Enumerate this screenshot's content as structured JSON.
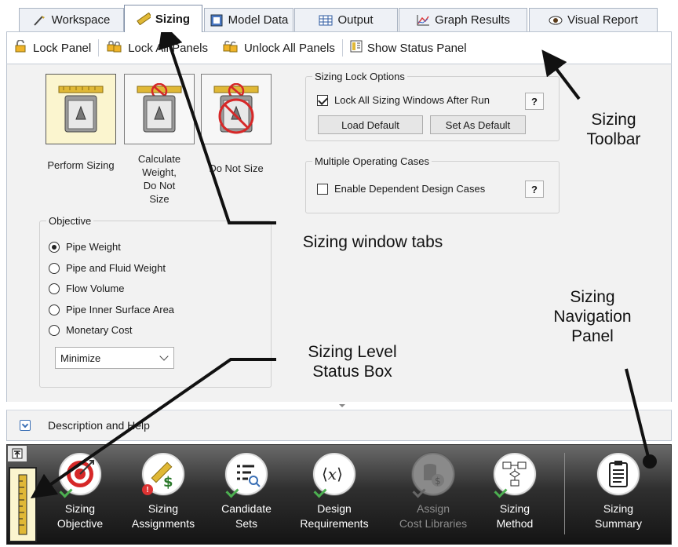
{
  "tabs": [
    {
      "label": "Workspace",
      "icon": "workspace-icon"
    },
    {
      "label": "Sizing",
      "icon": "ruler-icon",
      "active": true
    },
    {
      "label": "Model Data",
      "icon": "model-data-icon"
    },
    {
      "label": "Output",
      "icon": "table-icon"
    },
    {
      "label": "Graph Results",
      "icon": "graph-icon"
    },
    {
      "label": "Visual Report",
      "icon": "eye-icon"
    }
  ],
  "toolbar": {
    "lock_panel": "Lock Panel",
    "lock_all": "Lock All Panels",
    "unlock_all": "Unlock All Panels",
    "show_status": "Show Status Panel"
  },
  "sizing_mode": {
    "perform": "Perform Sizing",
    "calc_weight_1": "Calculate",
    "calc_weight_2": "Weight,",
    "calc_weight_3": "Do Not",
    "calc_weight_4": "Size",
    "do_not_size": "Do Not Size"
  },
  "lock_options": {
    "legend": "Sizing Lock Options",
    "lock_all_label": "Lock All Sizing Windows After Run",
    "lock_all_checked": true,
    "load_default": "Load Default",
    "set_default": "Set As Default",
    "help": "?"
  },
  "multi_cases": {
    "legend": "Multiple Operating Cases",
    "enable_label": "Enable Dependent Design Cases",
    "enable_checked": false,
    "help": "?"
  },
  "objective": {
    "legend": "Objective",
    "options": [
      "Pipe Weight",
      "Pipe and Fluid Weight",
      "Flow Volume",
      "Pipe Inner Surface Area",
      "Monetary Cost"
    ],
    "selected_index": 0,
    "direction": "Minimize"
  },
  "description": {
    "label": "Description and Help"
  },
  "nav": {
    "items": [
      {
        "line1": "Sizing",
        "line2": "Objective",
        "icon": "target-icon",
        "status": "ok",
        "enabled": true
      },
      {
        "line1": "Sizing",
        "line2": "Assignments",
        "icon": "ruler-dollar-icon",
        "status": "error",
        "enabled": true
      },
      {
        "line1": "Candidate",
        "line2": "Sets",
        "icon": "list-search-icon",
        "status": "ok",
        "enabled": true
      },
      {
        "line1": "Design",
        "line2": "Requirements",
        "icon": "function-x-icon",
        "status": "ok",
        "enabled": true
      },
      {
        "line1": "Assign",
        "line2": "Cost Libraries",
        "icon": "cost-library-icon",
        "status": "none",
        "enabled": false
      },
      {
        "line1": "Sizing",
        "line2": "Method",
        "icon": "flowchart-icon",
        "status": "ok",
        "enabled": true
      }
    ],
    "summary": {
      "line1": "Sizing",
      "line2": "Summary",
      "icon": "clipboard-list-icon"
    }
  },
  "annotations": {
    "toolbar_1": "Sizing",
    "toolbar_2": "Toolbar",
    "tabs": "Sizing window tabs",
    "nav_1": "Sizing",
    "nav_2": "Navigation",
    "nav_3": "Panel",
    "status_1": "Sizing Level",
    "status_2": "Status Box"
  },
  "colors": {
    "selected_fill": "#fbf5cf",
    "nav_dark": "#1f1f1f",
    "ok_green": "#4caf50",
    "error_red": "#dd3333",
    "target_red": "#d62828"
  }
}
